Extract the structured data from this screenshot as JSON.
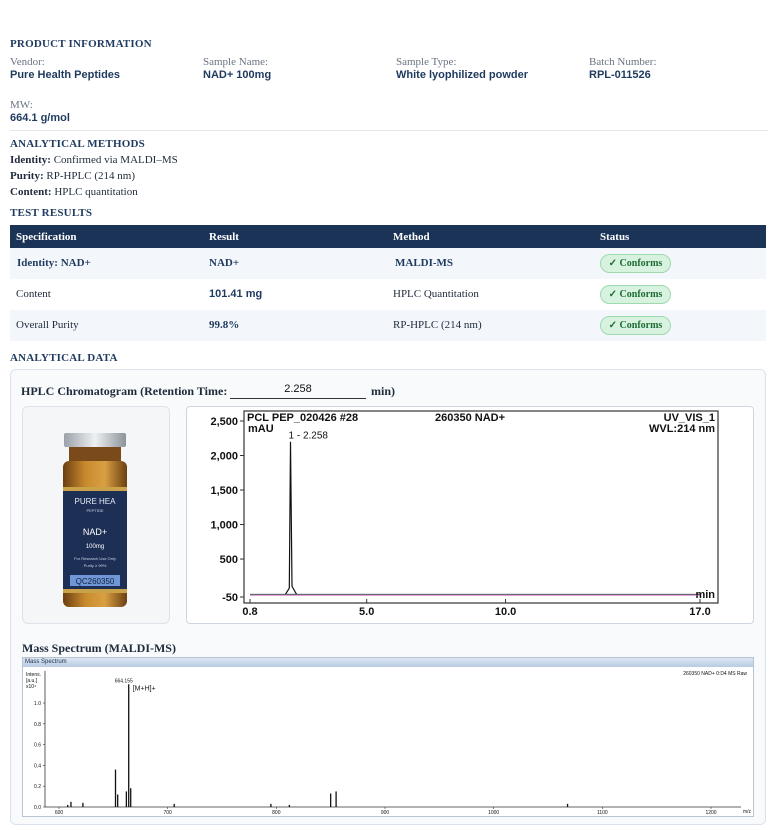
{
  "product_information": {
    "title": "PRODUCT INFORMATION",
    "vendor_label": "Vendor:",
    "vendor_value": "Pure Health Peptides",
    "sample_name_label": "Sample Name:",
    "sample_name_value": "NAD+ 100mg",
    "sample_type_label": "Sample Type:",
    "sample_type_value": "White lyophilized powder",
    "batch_label": "Batch Number:",
    "batch_value": "RPL-011526",
    "mw_label": "MW:",
    "mw_value": "664.1 g/mol"
  },
  "analytical_methods": {
    "title": "ANALYTICAL METHODS",
    "identity_label": "Identity:",
    "identity_value": "Confirmed via MALDI–MS",
    "purity_label": "Purity:",
    "purity_value": "RP-HPLC (214 nm)",
    "content_label": "Content:",
    "content_value": "HPLC quantitation"
  },
  "test_results": {
    "title": "TEST RESULTS",
    "headers": [
      "Specification",
      "Result",
      "Method",
      "Status"
    ],
    "rows": [
      {
        "spec": "Identity:  NAD+",
        "result": "NAD+",
        "method": "MALDI-MS",
        "status": "✓ Conforms"
      },
      {
        "spec": "Content",
        "result": "101.41  mg",
        "method": "HPLC Quantitation",
        "status": "✓ Conforms"
      },
      {
        "spec": "Overall Purity",
        "result": "99.8%",
        "method": "RP-HPLC (214 nm)",
        "status": "✓ Conforms"
      }
    ]
  },
  "analytical_data": {
    "title": "ANALYTICAL DATA",
    "hplc_title_prefix": "HPLC Chromatogram (Retention Time:",
    "retention_time": "2.258",
    "hplc_title_suffix": "min)",
    "ms_title": "Mass Spectrum (MALDI-MS)"
  },
  "vial_label": {
    "brand": "PURE HEA",
    "brand_sub": "PEPTIDE",
    "name": "NAD+",
    "amount": "100mg",
    "note1": "For Research Use Only",
    "note2": "Purity ≥ 99%",
    "code": "QC260350"
  },
  "colors": {
    "navy": "#1b3356",
    "badge_bg": "#d7f2de",
    "badge_text": "#1f6b36"
  },
  "chart_data": [
    {
      "type": "line",
      "header_left": "PCL PEP_020426 #28",
      "header_center": "260350 NAD+",
      "header_right": "UV_VIS_1",
      "header_right2": "WVL:214 nm",
      "ylabel": "mAU",
      "xlabel": "min",
      "xlim": [
        0.8,
        17.0
      ],
      "ylim": [
        -50,
        2500
      ],
      "x_ticks": [
        "0.8",
        "5.0",
        "10.0",
        "17.0"
      ],
      "x_tick_values": [
        0.8,
        5.0,
        10.0,
        17.0
      ],
      "y_ticks": [
        "2,500",
        "2,000",
        "1,500",
        "1,000",
        "500",
        "-50"
      ],
      "y_tick_values": [
        2500,
        2000,
        1500,
        1000,
        500,
        -50
      ],
      "peak_label": "1 - 2.258",
      "peaks": [
        {
          "x": 2.258,
          "y": 2200
        }
      ]
    },
    {
      "type": "line",
      "tab_label": "Mass Spectrum",
      "header_right": "260350 NAD+ 0:D4 MS Raw",
      "ylabel_lines": [
        "Intens.",
        "[a.u.]",
        "x10⁴"
      ],
      "xlabel": "m/z",
      "xlim": [
        600,
        1210
      ],
      "ylim": [
        0,
        1.25
      ],
      "x_ticks": [
        "600",
        "700",
        "800",
        "900",
        "1000",
        "1100",
        "1200"
      ],
      "x_tick_values": [
        600,
        700,
        800,
        900,
        1000,
        1100,
        1200
      ],
      "y_ticks": [
        "1.0",
        "0.8",
        "0.6",
        "0.4",
        "0.2",
        "0.0"
      ],
      "y_tick_values": [
        1.0,
        0.8,
        0.6,
        0.4,
        0.2,
        0.0
      ],
      "peak_label": "664.155",
      "peak_annotation": "[M+H]+",
      "peaks": [
        {
          "x": 608,
          "y": 0.02
        },
        {
          "x": 611,
          "y": 0.05
        },
        {
          "x": 622,
          "y": 0.04
        },
        {
          "x": 652,
          "y": 0.36
        },
        {
          "x": 654,
          "y": 0.12
        },
        {
          "x": 662,
          "y": 0.15
        },
        {
          "x": 664.155,
          "y": 1.18
        },
        {
          "x": 666,
          "y": 0.18
        },
        {
          "x": 706,
          "y": 0.03
        },
        {
          "x": 795,
          "y": 0.03
        },
        {
          "x": 812,
          "y": 0.02
        },
        {
          "x": 850,
          "y": 0.13
        },
        {
          "x": 855,
          "y": 0.15
        },
        {
          "x": 1068,
          "y": 0.03
        }
      ]
    }
  ]
}
